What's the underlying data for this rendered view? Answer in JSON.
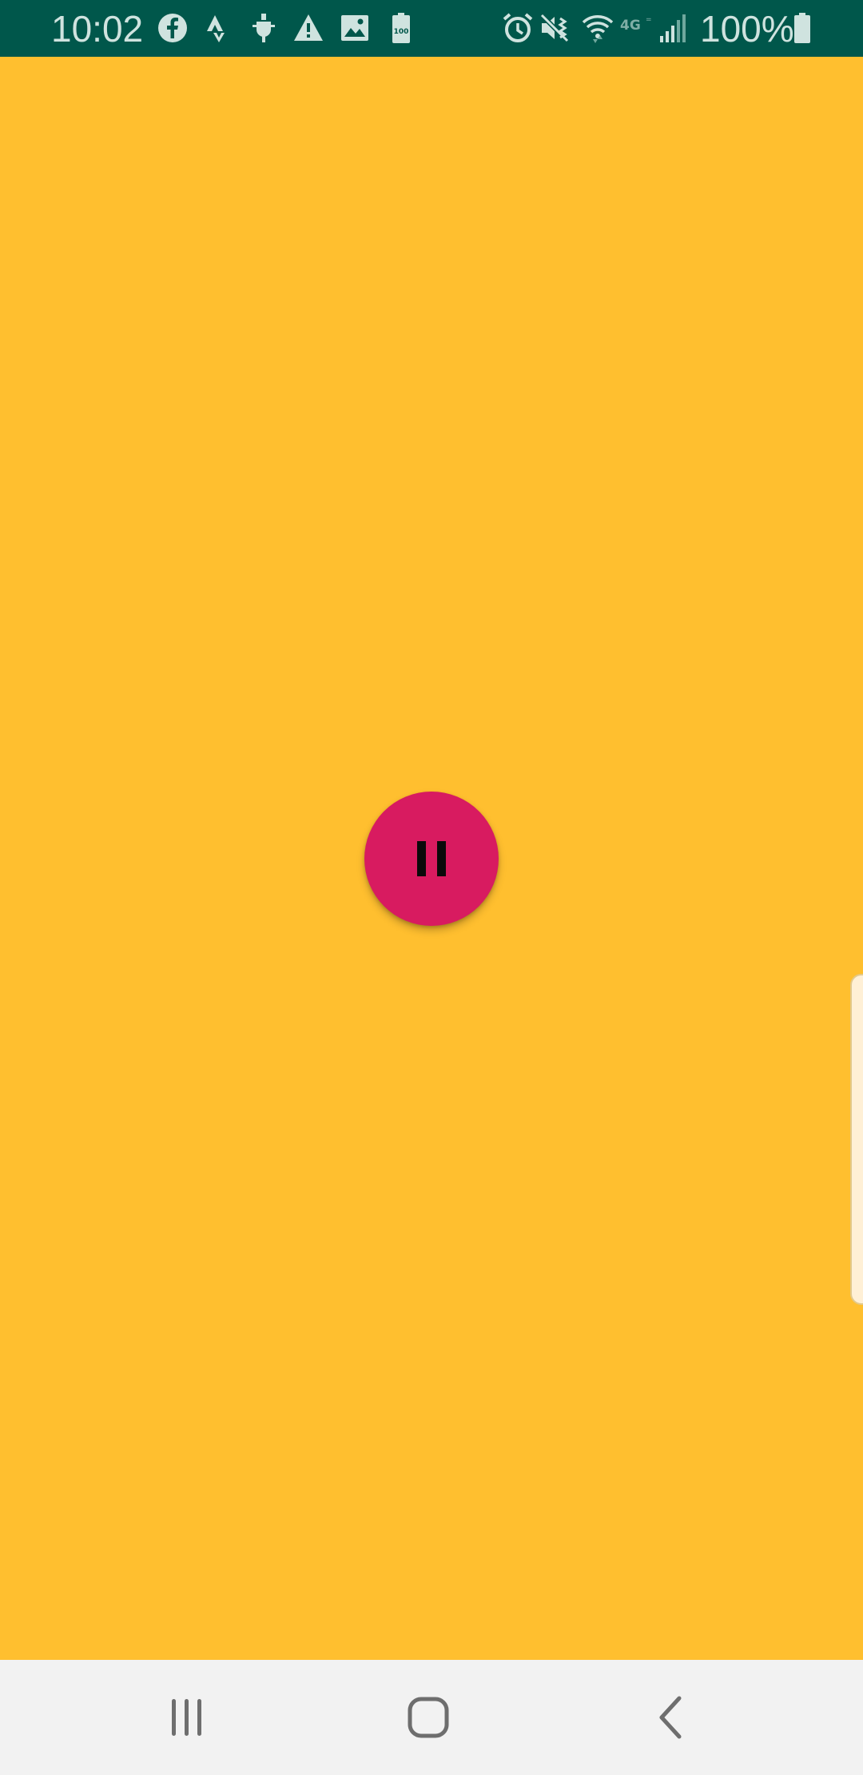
{
  "status_bar": {
    "time": "10:02",
    "battery_percent": "100%",
    "battery_icon_text": "100",
    "network_label": "4G",
    "left_icons": [
      "facebook-icon",
      "strava-icon",
      "usb-debug-icon",
      "warning-icon",
      "image-icon",
      "battery-saver-icon"
    ],
    "right_icons": [
      "alarm-icon",
      "vibrate-icon",
      "wifi-icon",
      "network-4g-icon",
      "signal-icon",
      "battery-icon"
    ]
  },
  "content": {
    "background_color": "#FFBF2F",
    "fab": {
      "icon": "pause-icon",
      "color": "#D81B60"
    }
  },
  "nav_bar": {
    "buttons": [
      "recent-apps",
      "home",
      "back"
    ]
  }
}
